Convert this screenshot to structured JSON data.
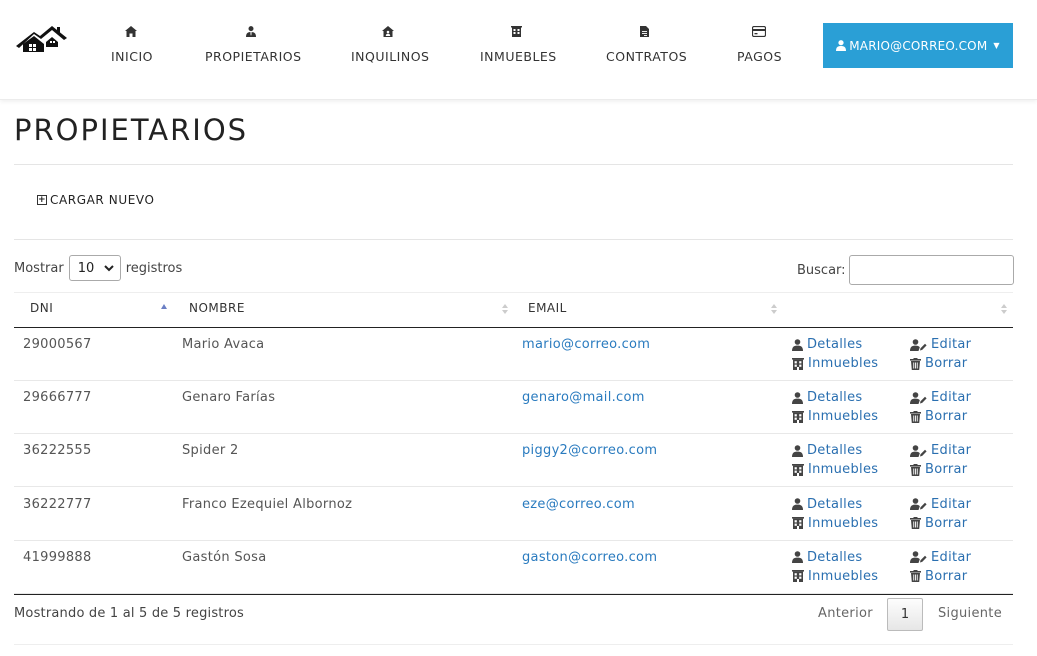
{
  "nav": {
    "items": [
      {
        "label": "INICIO",
        "icon": "home-icon"
      },
      {
        "label": "PROPIETARIOS",
        "icon": "user-tie-icon"
      },
      {
        "label": "INQUILINOS",
        "icon": "house-user-icon"
      },
      {
        "label": "INMUEBLES",
        "icon": "building-icon"
      },
      {
        "label": "CONTRATOS",
        "icon": "file-contract-icon"
      },
      {
        "label": "PAGOS",
        "icon": "credit-card-icon"
      }
    ],
    "user_label": "MARIO@CORREO.COM",
    "accent": "#2a9fd6"
  },
  "page": {
    "title": "PROPIETARIOS",
    "new_label": "CARGAR NUEVO"
  },
  "controls": {
    "show_prefix": "Mostrar",
    "page_size": "10",
    "show_suffix": "registros",
    "search_label": "Buscar:",
    "search_value": ""
  },
  "table": {
    "columns": [
      "DNI",
      "NOMBRE",
      "EMAIL",
      ""
    ],
    "sorted_column": "DNI",
    "rows": [
      {
        "dni": "29000567",
        "nombre": "Mario Avaca",
        "email": "mario@correo.com"
      },
      {
        "dni": "29666777",
        "nombre": "Genaro Farías",
        "email": "genaro@mail.com"
      },
      {
        "dni": "36222555",
        "nombre": "Spider 2",
        "email": "piggy2@correo.com"
      },
      {
        "dni": "36222777",
        "nombre": "Franco Ezequiel Albornoz",
        "email": "eze@correo.com"
      },
      {
        "dni": "41999888",
        "nombre": "Gastón Sosa",
        "email": "gaston@correo.com"
      }
    ],
    "actions": {
      "details": "Detalles",
      "edit": "Editar",
      "properties": "Inmuebles",
      "delete": "Borrar"
    }
  },
  "footer": {
    "info": "Mostrando de 1 al 5 de 5 registros",
    "prev": "Anterior",
    "page": "1",
    "next": "Siguiente"
  }
}
